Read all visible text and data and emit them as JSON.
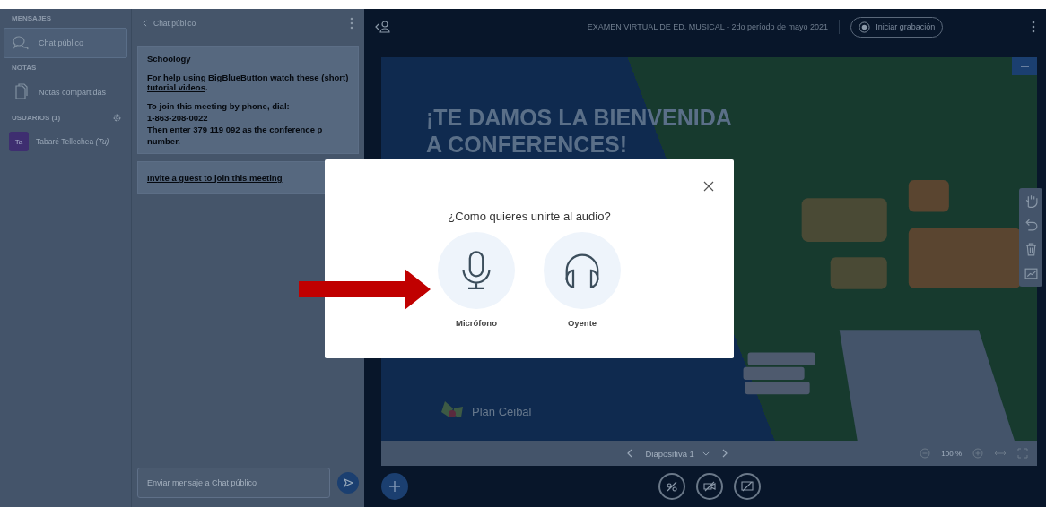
{
  "sidebar": {
    "messages_title": "MENSAJES",
    "messages": [
      {
        "label": "Chat público",
        "selected": true
      }
    ],
    "notes_title": "NOTAS",
    "notes": [
      {
        "label": "Notas compartidas"
      }
    ],
    "users_title": "USUARIOS (1)",
    "users": [
      {
        "initials": "Ta",
        "name": "Tabaré Tellechea",
        "suffix": "(Tu)"
      }
    ]
  },
  "chat": {
    "title": "Chat público",
    "heading": "Schoology",
    "help": "For help using BigBlueButton watch these (short)",
    "help_link": "tutorial videos",
    "help_end": ".",
    "phone_intro": "To join this meeting by phone, dial:",
    "phone": "1-863-208-0022",
    "pin": "Then enter 379 119 092 as the conference p",
    "pin_end": "number.",
    "invite": "Invite a guest to join this meeting",
    "input": {
      "placeholder": "Enviar mensaje a Chat público"
    }
  },
  "header": {
    "title": "EXAMEN VIRTUAL DE ED. MUSICAL - 2do período de mayo 2021",
    "record": "Iniciar grabación"
  },
  "slide": {
    "heading": [
      "¡TE DAMOS LA BIENVENIDA",
      "A CONFERENCES!"
    ],
    "logo": "Plan Ceibal"
  },
  "slide_bar": {
    "slide": "Diapositiva 1",
    "zoom": "100 %"
  },
  "modal": {
    "question": "¿Como quieres unirte al audio?",
    "options": [
      {
        "kind": "microphone",
        "label": "Micrófono"
      },
      {
        "kind": "headphones",
        "label": "Oyente"
      }
    ]
  }
}
